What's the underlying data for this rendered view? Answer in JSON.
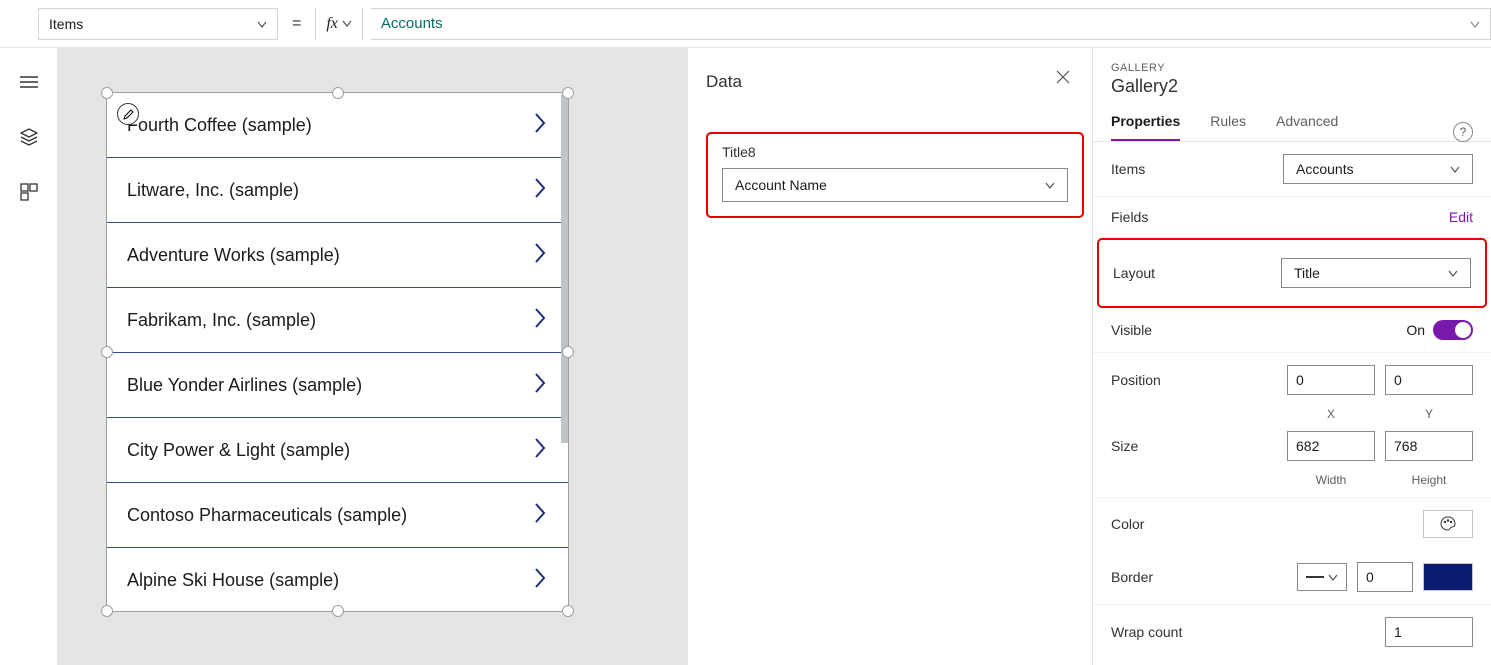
{
  "formula_bar": {
    "property": "Items",
    "formula": "Accounts"
  },
  "gallery": {
    "items": [
      "Fourth Coffee (sample)",
      "Litware, Inc. (sample)",
      "Adventure Works (sample)",
      "Fabrikam, Inc. (sample)",
      "Blue Yonder Airlines (sample)",
      "City Power & Light (sample)",
      "Contoso Pharmaceuticals (sample)",
      "Alpine Ski House (sample)"
    ]
  },
  "data_panel": {
    "title": "Data",
    "field_label": "Title8",
    "field_value": "Account Name"
  },
  "properties_panel": {
    "supertitle": "GALLERY",
    "name": "Gallery2",
    "tabs": {
      "properties": "Properties",
      "rules": "Rules",
      "advanced": "Advanced"
    },
    "items_label": "Items",
    "items_value": "Accounts",
    "fields_label": "Fields",
    "fields_action": "Edit",
    "layout_label": "Layout",
    "layout_value": "Title",
    "visible_label": "Visible",
    "visible_value": "On",
    "position_label": "Position",
    "position_x": "0",
    "position_y": "0",
    "position_x_label": "X",
    "position_y_label": "Y",
    "size_label": "Size",
    "size_w": "682",
    "size_h": "768",
    "size_w_label": "Width",
    "size_h_label": "Height",
    "color_label": "Color",
    "border_label": "Border",
    "border_width": "0",
    "wrap_label": "Wrap count",
    "wrap_value": "1"
  }
}
